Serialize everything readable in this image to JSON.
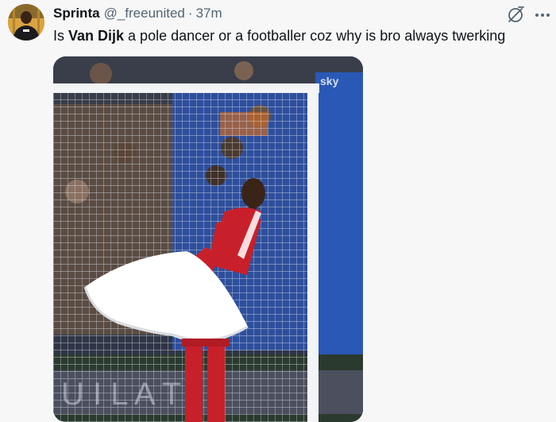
{
  "author": {
    "display_name": "Sprinta",
    "handle": "@_freeunited",
    "separator": "·",
    "timestamp": "37m"
  },
  "tweet": {
    "text_before": "Is ",
    "text_bold": "Van Dijk",
    "text_after": " a pole dancer or a footballer coz why is bro always twerking"
  },
  "actions": {
    "grok_icon": "grok-icon",
    "more_icon": "more-icon"
  },
  "media": {
    "watermark": "sky",
    "description_colors": {
      "shirt": "#c8202a",
      "skirt": "#ffffff",
      "seats": "#1f4fa8"
    }
  }
}
